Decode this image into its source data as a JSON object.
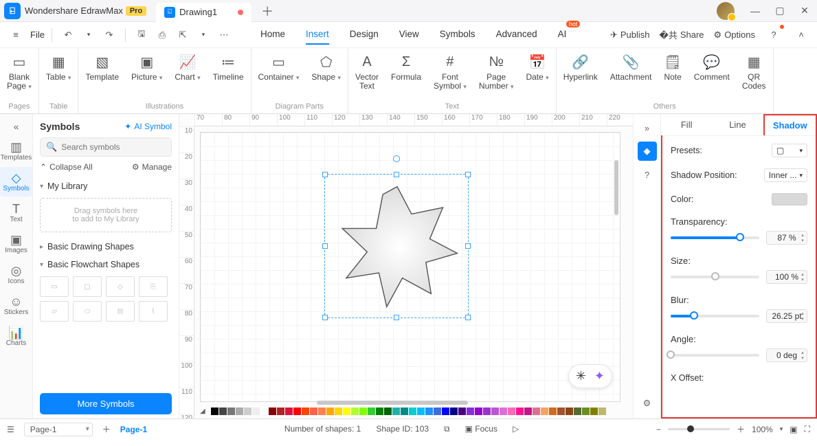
{
  "titlebar": {
    "app_name": "Wondershare EdrawMax",
    "pro": "Pro",
    "doc_tab": "Drawing1",
    "win": {
      "min": "—",
      "max": "▢",
      "close": "✕"
    }
  },
  "menubar": {
    "file": "File",
    "menus": [
      "Home",
      "Insert",
      "Design",
      "View",
      "Symbols",
      "Advanced",
      "AI"
    ],
    "active": "Insert",
    "right": {
      "publish": "Publish",
      "share": "Share",
      "options": "Options"
    }
  },
  "ribbon": {
    "groups": [
      {
        "label": "Pages",
        "items": [
          {
            "l": "Blank\nPage",
            "drop": true,
            "i": "▭"
          }
        ]
      },
      {
        "label": "Table",
        "items": [
          {
            "l": "Table",
            "drop": true,
            "i": "▦"
          }
        ]
      },
      {
        "label": "Illustrations",
        "items": [
          {
            "l": "Template",
            "i": "▧"
          },
          {
            "l": "Picture",
            "drop": true,
            "i": "▣"
          },
          {
            "l": "Chart",
            "drop": true,
            "i": "📈"
          },
          {
            "l": "Timeline",
            "i": "≔"
          }
        ]
      },
      {
        "label": "Diagram Parts",
        "items": [
          {
            "l": "Container",
            "drop": true,
            "i": "▭"
          },
          {
            "l": "Shape",
            "drop": true,
            "i": "⬠"
          }
        ]
      },
      {
        "label": "Text",
        "items": [
          {
            "l": "Vector\nText",
            "i": "A"
          },
          {
            "l": "Formula",
            "i": "Σ"
          },
          {
            "l": "Font\nSymbol",
            "drop": true,
            "i": "#"
          },
          {
            "l": "Page\nNumber",
            "drop": true,
            "i": "№"
          },
          {
            "l": "Date",
            "drop": true,
            "i": "📅"
          }
        ]
      },
      {
        "label": "Others",
        "items": [
          {
            "l": "Hyperlink",
            "i": "🔗"
          },
          {
            "l": "Attachment",
            "i": "📎"
          },
          {
            "l": "Note",
            "i": "🗒"
          },
          {
            "l": "Comment",
            "i": "💬"
          },
          {
            "l": "QR\nCodes",
            "i": "▦"
          }
        ]
      }
    ]
  },
  "leftrail": [
    {
      "l": "Templates",
      "i": "▥"
    },
    {
      "l": "Symbols",
      "i": "◇",
      "active": true
    },
    {
      "l": "Text",
      "i": "T"
    },
    {
      "l": "Images",
      "i": "▣"
    },
    {
      "l": "Icons",
      "i": "◎"
    },
    {
      "l": "Stickers",
      "i": "☺"
    },
    {
      "l": "Charts",
      "i": "📊"
    }
  ],
  "sidepanel": {
    "title": "Symbols",
    "ai": "AI Symbol",
    "search_ph": "Search symbols",
    "collapse": "Collapse All",
    "manage": "Manage",
    "mylib": "My Library",
    "drop1": "Drag symbols here",
    "drop2": "to add to My Library",
    "sec1": "Basic Drawing Shapes",
    "sec2": "Basic Flowchart Shapes",
    "more": "More Symbols"
  },
  "ruler_x": [
    "70",
    "80",
    "90",
    "100",
    "110",
    "120",
    "130",
    "140",
    "150",
    "160",
    "170",
    "180",
    "190",
    "200",
    "210",
    "220"
  ],
  "ruler_y": [
    "10",
    "20",
    "30",
    "40",
    "50",
    "60",
    "70",
    "80",
    "90",
    "100",
    "110",
    "120"
  ],
  "proppanel": {
    "tabs": [
      "Fill",
      "Line",
      "Shadow"
    ],
    "active": "Shadow",
    "presets": "Presets:",
    "shadow_pos": "Shadow Position:",
    "shadow_pos_val": "Inner ...",
    "color": "Color:",
    "transparency": "Transparency:",
    "transparency_val": "87 %",
    "size": "Size:",
    "size_val": "100 %",
    "blur": "Blur:",
    "blur_val": "26.25 pt",
    "angle": "Angle:",
    "angle_val": "0 deg",
    "xoffset": "X Offset:"
  },
  "statusbar": {
    "page_sel": "Page-1",
    "page_active": "Page-1",
    "shapes": "Number of shapes: 1",
    "shape_id": "Shape ID: 103",
    "focus": "Focus",
    "zoom": "100%"
  },
  "palette": [
    "#000",
    "#444",
    "#777",
    "#aaa",
    "#ccc",
    "#eee",
    "#fff",
    "#8b0000",
    "#b22222",
    "#dc143c",
    "#ff0000",
    "#ff4500",
    "#ff6347",
    "#ff7f50",
    "#ffa500",
    "#ffd700",
    "#ffff00",
    "#adff2f",
    "#7fff00",
    "#32cd32",
    "#008000",
    "#006400",
    "#20b2aa",
    "#008b8b",
    "#00ced1",
    "#00bfff",
    "#1e90ff",
    "#4169e1",
    "#0000ff",
    "#00008b",
    "#4b0082",
    "#8a2be2",
    "#9400d3",
    "#9932cc",
    "#ba55d3",
    "#da70d6",
    "#ff69b4",
    "#ff1493",
    "#c71585",
    "#db7093",
    "#f4a460",
    "#d2691e",
    "#a0522d",
    "#8b4513",
    "#556b2f",
    "#6b8e23",
    "#808000",
    "#bdb76b"
  ]
}
